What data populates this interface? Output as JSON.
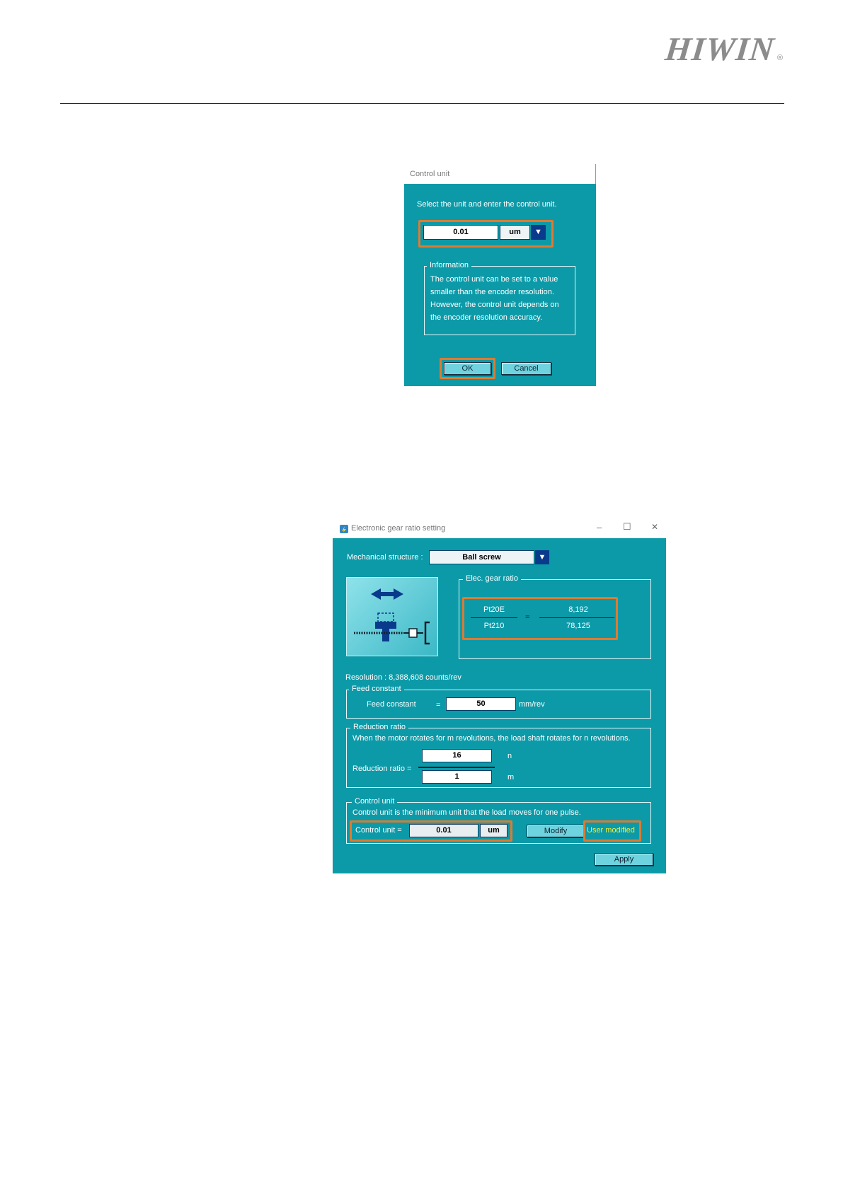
{
  "header": {
    "logo": "HIWIN",
    "logo_mark": "®"
  },
  "control_unit_dialog": {
    "title": "Control unit",
    "prompt": "Select the unit and enter the control unit.",
    "value": "0.01",
    "unit": "um",
    "info_title": "Information",
    "info_lines": [
      "The control unit can be set to a value",
      "smaller than the encoder resolution.",
      "However, the control unit depends on",
      "the encoder resolution accuracy."
    ],
    "ok_label": "OK",
    "cancel_label": "Cancel"
  },
  "gear_dialog": {
    "title": "Electronic gear ratio setting",
    "window_controls": {
      "minimize": "–",
      "maximize": "☐",
      "close": "✕"
    },
    "mechanical_structure_label": "Mechanical structure :",
    "mechanical_structure_value": "Ball screw",
    "gear_ratio_title": "Elec. gear ratio",
    "gear_ratio": {
      "num_param": "Pt20E",
      "den_param": "Pt210",
      "equals": "=",
      "num_value": "8,192",
      "den_value": "78,125"
    },
    "resolution_text": "Resolution : 8,388,608 counts/rev",
    "feed_constant": {
      "group_title": "Feed constant",
      "label": "Feed constant",
      "equals": "=",
      "value": "50",
      "unit": "mm/rev"
    },
    "reduction_ratio": {
      "group_title": "Reduction ratio",
      "description": "When the motor rotates for m revolutions, the load shaft rotates for n revolutions.",
      "label": "Reduction ratio  =",
      "n_value": "16",
      "n_label": "n",
      "m_value": "1",
      "m_label": "m"
    },
    "control_unit": {
      "group_title": "Control unit",
      "description": "Control unit is the minimum unit that the load moves for one pulse.",
      "label": "Control unit  =",
      "value": "0.01",
      "unit": "um",
      "modify_label": "Modify",
      "status": "User modified"
    },
    "apply_label": "Apply"
  },
  "colors": {
    "dialog_bg": "#0c9aa8",
    "highlight": "#e07a2f",
    "status_text": "#f2ef3a",
    "logo": "#8c8c8c"
  }
}
